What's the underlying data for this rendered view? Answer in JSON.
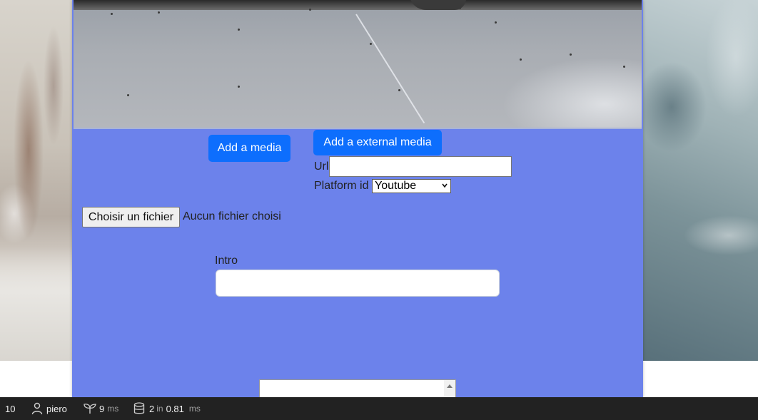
{
  "form": {
    "add_media_label": "Add a media",
    "add_external_media_label": "Add a external media",
    "url_label": "Url",
    "url_value": "",
    "platform_label": "Platform id",
    "platform_selected": "Youtube",
    "file_button_label": "Choisir un fichier",
    "file_status": "Aucun fichier choisi",
    "intro_label": "Intro",
    "intro_value": ""
  },
  "toolbar": {
    "status_code": "10",
    "user": "piero",
    "time_value": "9",
    "time_unit": "ms",
    "db_queries": "2",
    "db_in": "in",
    "db_time": "0.81",
    "db_unit": "ms"
  },
  "icons": {
    "user": "user-icon",
    "time": "sprout-icon",
    "database": "database-icon"
  },
  "colors": {
    "card": "#6c82eb",
    "primary_button": "#0d6efd",
    "toolbar": "#222222"
  }
}
